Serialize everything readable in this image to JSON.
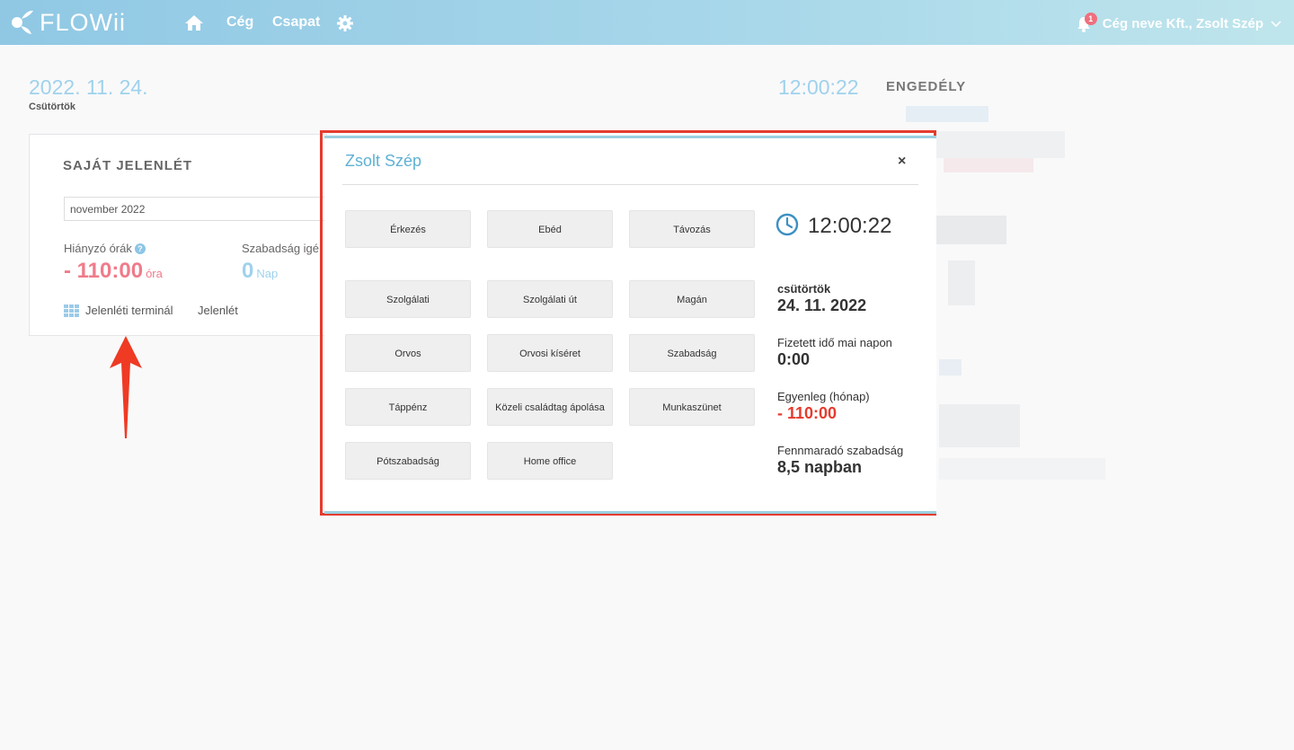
{
  "app": {
    "logo_text": "FLOWii",
    "nav": {
      "company": "Cég",
      "team": "Csapat"
    },
    "user_label": "Cég neve Kft., Zsolt Szép",
    "notification_count": "1",
    "accent_color": "#9fd2ec"
  },
  "dashboard": {
    "date": "2022. 11. 24.",
    "weekday": "Csütörtök",
    "clock": "12:00:22",
    "engedely_heading": "ENGEDÉLY"
  },
  "card": {
    "title": "SAJÁT JELENLÉT",
    "month_value": "november 2022",
    "missing_hours_label": "Hiányzó órák",
    "missing_hours_value": "- 110:00",
    "missing_hours_unit": "óra",
    "leave_request_label": "Szabadság igé",
    "leave_request_value": "0",
    "leave_request_unit": "Nap",
    "terminal_link": "Jelenléti terminál",
    "attendance_link": "Jelenlét"
  },
  "modal": {
    "title": "Zsolt Szép",
    "close_label": "×",
    "buttons": {
      "arrival": "Érkezés",
      "lunch": "Ebéd",
      "departure": "Távozás",
      "official": "Szolgálati",
      "business_trip": "Szolgálati út",
      "private": "Magán",
      "doctor": "Orvos",
      "doctor_escort": "Orvosi kíséret",
      "vacation": "Szabadság",
      "sick_pay": "Táppénz",
      "family_care": "Közeli családtag ápolása",
      "public_holiday": "Munkaszünet",
      "extra_leave": "Pótszabadság",
      "home_office": "Home office"
    },
    "time": "12:00:22",
    "weekday": "csütörtök",
    "date": "24. 11. 2022",
    "paid_time_label": "Fizetett idő mai napon",
    "paid_time_value": "0:00",
    "balance_label": "Egyenleg (hónap)",
    "balance_value": "- 110:00",
    "remaining_leave_label": "Fennmaradó szabadság",
    "remaining_leave_value": "8,5 napban"
  }
}
